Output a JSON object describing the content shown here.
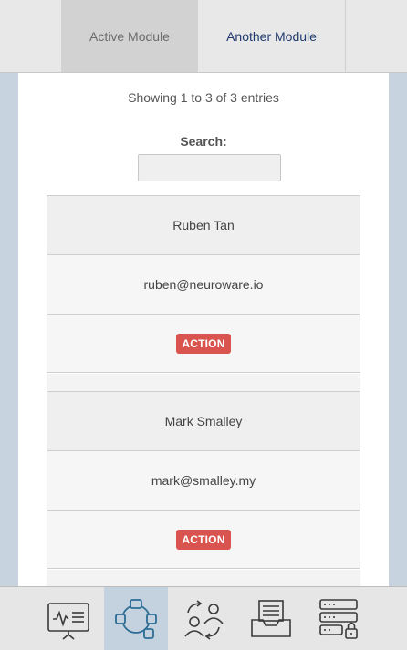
{
  "nav": {
    "tabs": [
      {
        "label": "Active Module",
        "active": true
      },
      {
        "label": "Another Module",
        "active": false
      }
    ]
  },
  "table": {
    "info": "Showing 1 to 3 of 3 entries",
    "search_label": "Search:",
    "search_value": "",
    "records": [
      {
        "name": "Ruben Tan",
        "email": "ruben@neuroware.io",
        "action_label": "ACTION"
      },
      {
        "name": "Mark Smalley",
        "email": "mark@smalley.my",
        "action_label": "ACTION"
      }
    ]
  },
  "toolbar": {
    "items": [
      {
        "icon": "presentation-chart-icon",
        "active": false
      },
      {
        "icon": "network-nodes-icon",
        "active": true
      },
      {
        "icon": "user-exchange-icon",
        "active": false
      },
      {
        "icon": "inbox-tray-icon",
        "active": false
      },
      {
        "icon": "secure-server-icon",
        "active": false
      }
    ]
  },
  "colors": {
    "accent_text": "#1f3a6e",
    "action_button": "#d9534f",
    "active_tool_bg": "#c3d2de",
    "page_bg": "#c7d4e0"
  }
}
